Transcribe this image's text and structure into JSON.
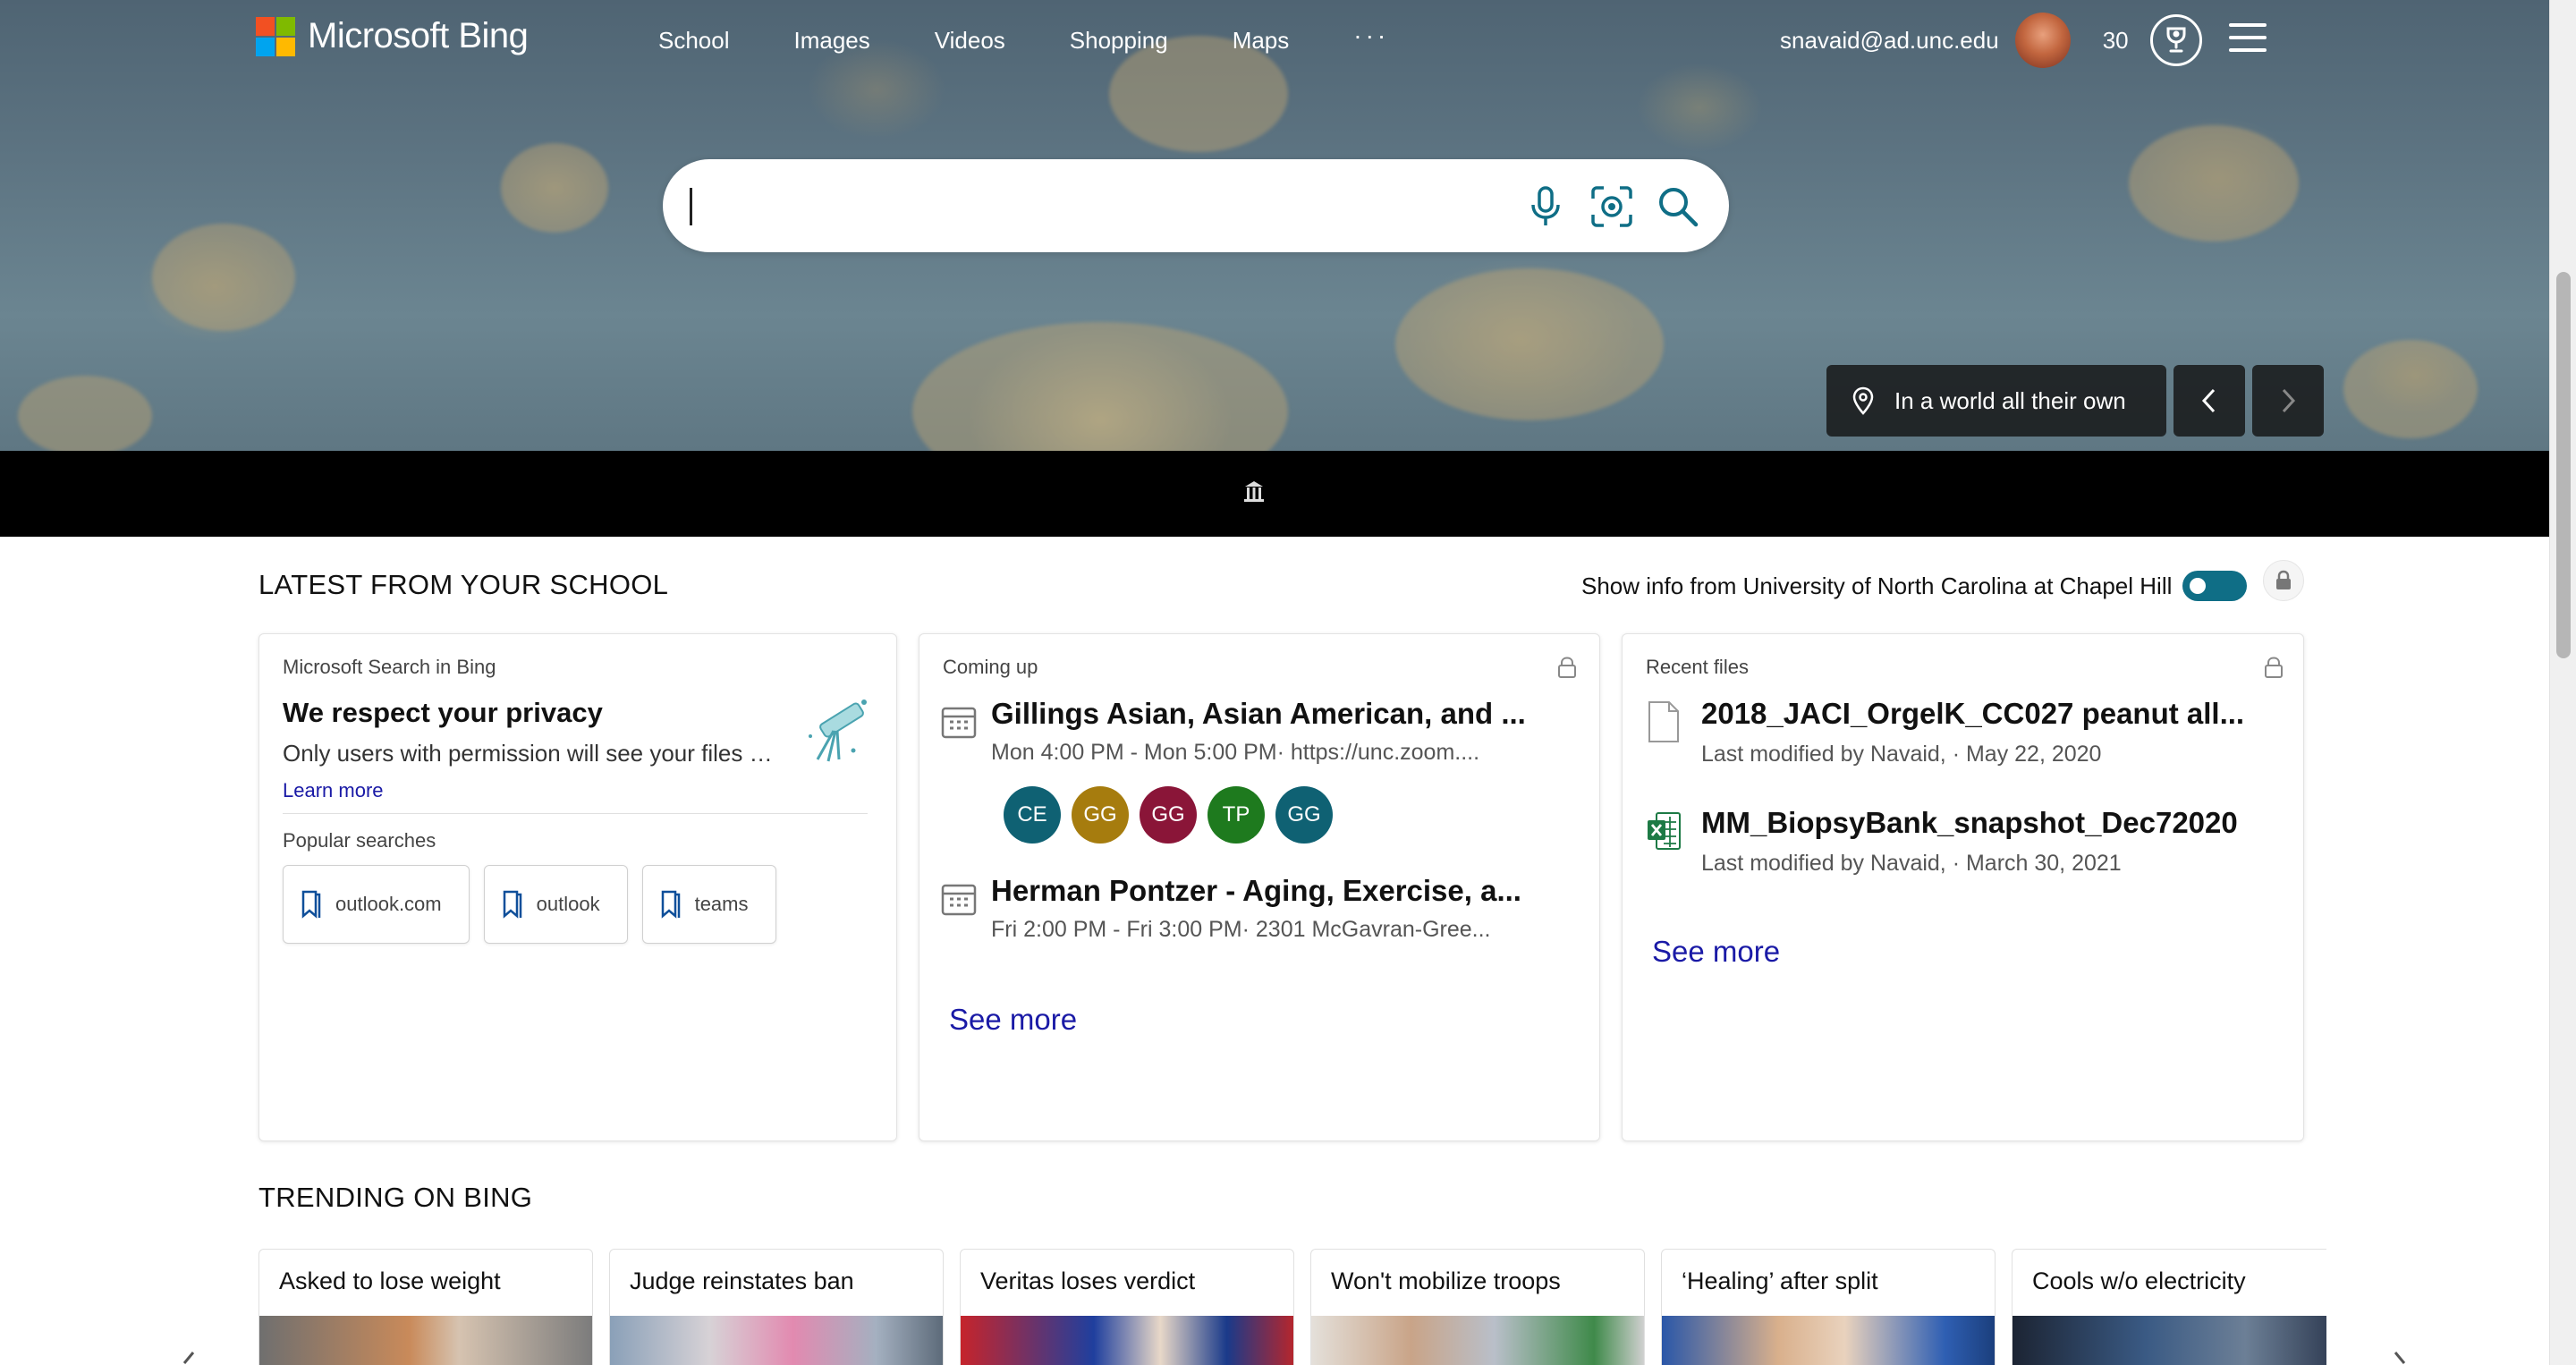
{
  "header": {
    "logo_text": "Microsoft Bing",
    "logo_colors": [
      "#f25022",
      "#7fba00",
      "#00a4ef",
      "#ffb900"
    ],
    "nav": [
      {
        "label": "School"
      },
      {
        "label": "Images"
      },
      {
        "label": "Videos"
      },
      {
        "label": "Shopping"
      },
      {
        "label": "Maps"
      }
    ],
    "more_label": "···",
    "email": "snavaid@ad.unc.edu",
    "points": "30"
  },
  "search": {
    "placeholder": "",
    "value": ""
  },
  "hero": {
    "caption": "In a world all their own"
  },
  "school": {
    "title": "LATEST FROM YOUR SCHOOL",
    "toggle_label": "Show info from University of North Carolina at Chapel Hill",
    "toggle_on": true,
    "privacy_card": {
      "label": "Microsoft Search in Bing",
      "title": "We respect your privacy",
      "desc": "Only users with permission will see your files and data",
      "learn_more": "Learn more",
      "popular_label": "Popular searches",
      "popular": [
        {
          "label": "outlook.com"
        },
        {
          "label": "outlook"
        },
        {
          "label": "teams"
        }
      ]
    },
    "events_card": {
      "label": "Coming up",
      "events": [
        {
          "title": "Gillings Asian, Asian American, and ...",
          "time": "Mon 4:00 PM - Mon 5:00 PM· https://unc.zoom...."
        },
        {
          "title": "Herman Pontzer - Aging, Exercise, a...",
          "time": "Fri 2:00 PM - Fri 3:00 PM· 2301 McGavran-Gree..."
        }
      ],
      "attendees": [
        {
          "initials": "CE",
          "color": "#0f6173"
        },
        {
          "initials": "GG",
          "color": "#a67c0e"
        },
        {
          "initials": "GG",
          "color": "#8a1538"
        },
        {
          "initials": "TP",
          "color": "#1e7a1e"
        },
        {
          "initials": "GG",
          "color": "#0f6173"
        }
      ],
      "see_more": "See more"
    },
    "files_card": {
      "label": "Recent files",
      "files": [
        {
          "title": "2018_JACI_OrgelK_CC027 peanut all...",
          "meta": "Last modified by Navaid, · May 22, 2020",
          "icon": "file-icon"
        },
        {
          "title": "MM_BiopsyBank_snapshot_Dec72020",
          "meta": "Last modified by Navaid, · March 30, 2021",
          "icon": "excel-icon"
        }
      ],
      "see_more": "See more"
    }
  },
  "trending": {
    "title": "TRENDING ON BING",
    "items": [
      {
        "title": "Asked to lose weight"
      },
      {
        "title": "Judge reinstates ban"
      },
      {
        "title": "Veritas loses verdict"
      },
      {
        "title": "Won't mobilize troops"
      },
      {
        "title": "‘Healing’ after split"
      },
      {
        "title": "Cools w/o electricity"
      }
    ]
  },
  "colors": {
    "accent": "#0f6e86",
    "link": "#1a1aa6"
  }
}
